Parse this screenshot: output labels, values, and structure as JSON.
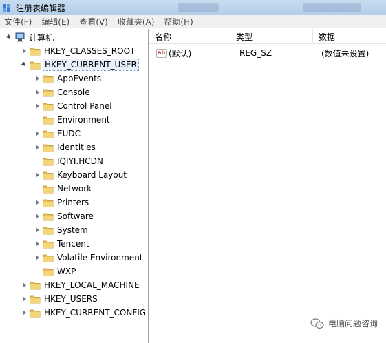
{
  "window": {
    "title": "注册表编辑器"
  },
  "menu": [
    "文件(F)",
    "编辑(E)",
    "查看(V)",
    "收藏夹(A)",
    "帮助(H)"
  ],
  "tree": {
    "root": "计算机",
    "hives": [
      {
        "label": "HKEY_CLASSES_ROOT"
      },
      {
        "label": "HKEY_CURRENT_USER",
        "expanded": true,
        "selected": true
      },
      {
        "label": "HKEY_LOCAL_MACHINE"
      },
      {
        "label": "HKEY_USERS"
      },
      {
        "label": "HKEY_CURRENT_CONFIG"
      }
    ],
    "hkcu_children": [
      "AppEvents",
      "Console",
      "Control Panel",
      "Environment",
      "EUDC",
      "Identities",
      "IQIYI.HCDN",
      "Keyboard Layout",
      "Network",
      "Printers",
      "Software",
      "System",
      "Tencent",
      "Volatile Environment",
      "WXP"
    ]
  },
  "list": {
    "columns": [
      "名称",
      "类型",
      "数据"
    ],
    "rows": [
      {
        "name": "(默认)",
        "type": "REG_SZ",
        "data": "(数值未设置)",
        "icon": "ab-string-icon"
      }
    ]
  },
  "watermark": {
    "text": "电脑问题咨询",
    "icon": "wechat-icon"
  },
  "colors": {
    "folder": "#e8c05a",
    "selection_border": "#7a96c0",
    "titlebar": "#c9dcf0",
    "menubar": "#f0f0f0"
  }
}
